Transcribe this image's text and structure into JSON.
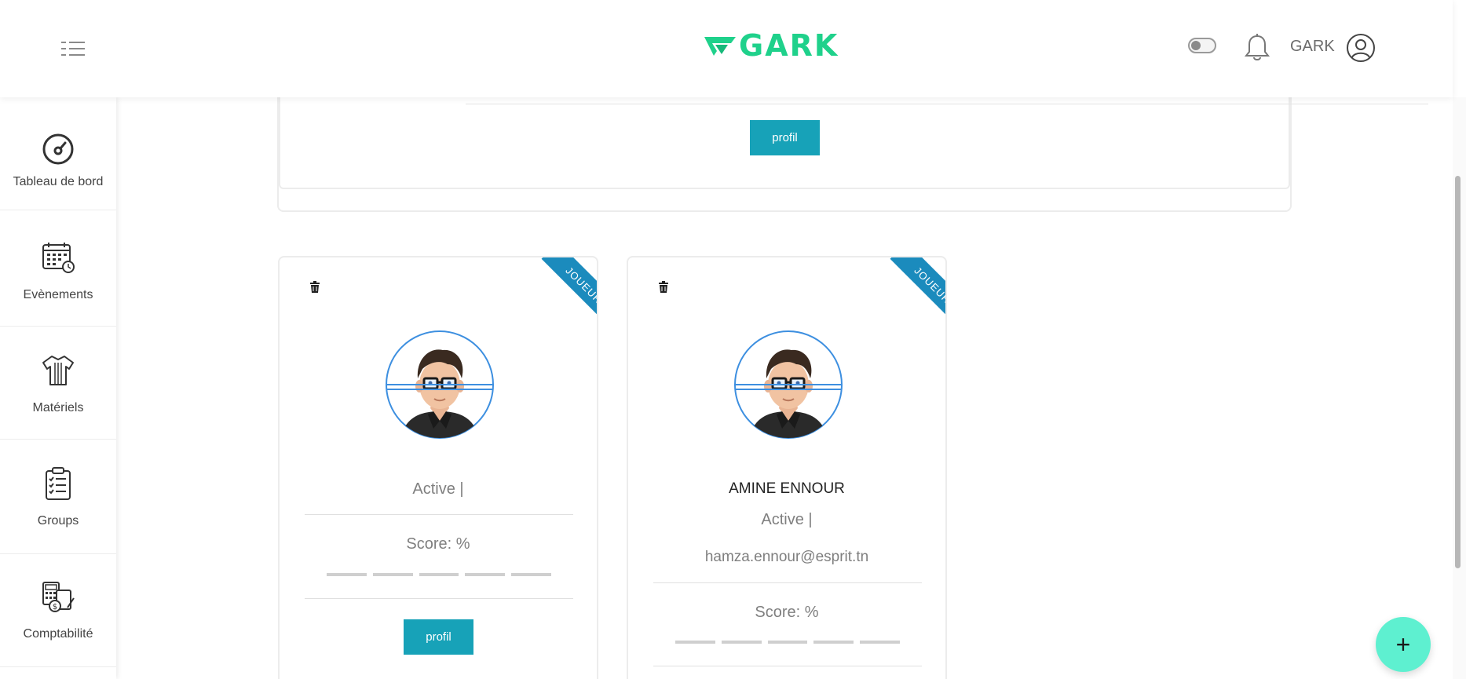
{
  "header": {
    "logo_text": "GARK",
    "user_name": "GARK",
    "brand_color": "#1fd18b",
    "icons": [
      "menu-list-icon",
      "theme-toggle",
      "bell-icon",
      "user-circle-icon"
    ]
  },
  "sidebar": {
    "items": [
      {
        "label": "Tableau de bord",
        "icon": "speedometer-icon"
      },
      {
        "label": "Evènements",
        "icon": "calendar-clock-icon"
      },
      {
        "label": "Matériels",
        "icon": "jersey-icon"
      },
      {
        "label": "Groups",
        "icon": "clipboard-checklist-icon"
      },
      {
        "label": "Comptabilité",
        "icon": "accounting-calculator-icon"
      }
    ]
  },
  "main": {
    "top_card": {
      "button_label": "profil"
    },
    "players": [
      {
        "ribbon": "JOUEUR",
        "name": "",
        "status": "Active |",
        "email": "",
        "score": "Score: %",
        "button_label": "profil"
      },
      {
        "ribbon": "JOUEUR",
        "name": "AMINE ENNOUR",
        "status": "Active |",
        "email": "hamza.ennour@esprit.tn",
        "score": "Score: %"
      }
    ]
  },
  "fab": {
    "label": "+",
    "color": "#5ef0d0"
  },
  "colors": {
    "button": "#17a2b8",
    "ribbon": "#1b8bbd",
    "avatar_ring": "#3d8fe0"
  }
}
